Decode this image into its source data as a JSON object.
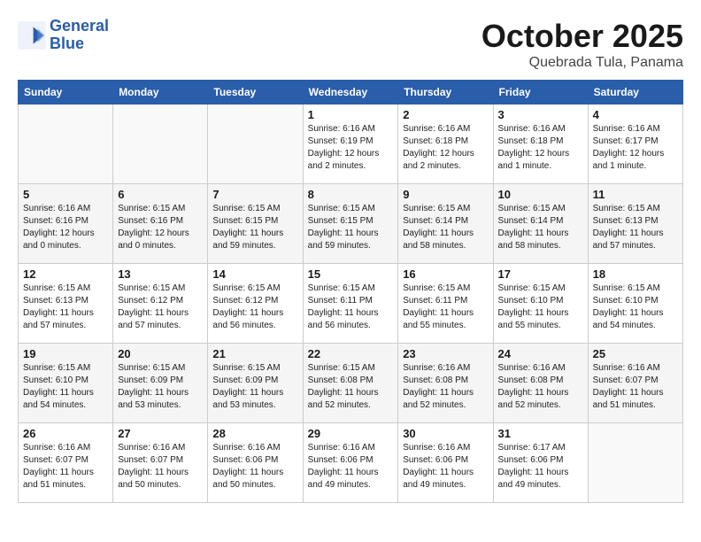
{
  "header": {
    "logo_line1": "General",
    "logo_line2": "Blue",
    "month": "October 2025",
    "location": "Quebrada Tula, Panama"
  },
  "weekdays": [
    "Sunday",
    "Monday",
    "Tuesday",
    "Wednesday",
    "Thursday",
    "Friday",
    "Saturday"
  ],
  "weeks": [
    [
      {
        "day": "",
        "info": ""
      },
      {
        "day": "",
        "info": ""
      },
      {
        "day": "",
        "info": ""
      },
      {
        "day": "1",
        "info": "Sunrise: 6:16 AM\nSunset: 6:19 PM\nDaylight: 12 hours and 2 minutes."
      },
      {
        "day": "2",
        "info": "Sunrise: 6:16 AM\nSunset: 6:18 PM\nDaylight: 12 hours and 2 minutes."
      },
      {
        "day": "3",
        "info": "Sunrise: 6:16 AM\nSunset: 6:18 PM\nDaylight: 12 hours and 1 minute."
      },
      {
        "day": "4",
        "info": "Sunrise: 6:16 AM\nSunset: 6:17 PM\nDaylight: 12 hours and 1 minute."
      }
    ],
    [
      {
        "day": "5",
        "info": "Sunrise: 6:16 AM\nSunset: 6:16 PM\nDaylight: 12 hours and 0 minutes."
      },
      {
        "day": "6",
        "info": "Sunrise: 6:15 AM\nSunset: 6:16 PM\nDaylight: 12 hours and 0 minutes."
      },
      {
        "day": "7",
        "info": "Sunrise: 6:15 AM\nSunset: 6:15 PM\nDaylight: 11 hours and 59 minutes."
      },
      {
        "day": "8",
        "info": "Sunrise: 6:15 AM\nSunset: 6:15 PM\nDaylight: 11 hours and 59 minutes."
      },
      {
        "day": "9",
        "info": "Sunrise: 6:15 AM\nSunset: 6:14 PM\nDaylight: 11 hours and 58 minutes."
      },
      {
        "day": "10",
        "info": "Sunrise: 6:15 AM\nSunset: 6:14 PM\nDaylight: 11 hours and 58 minutes."
      },
      {
        "day": "11",
        "info": "Sunrise: 6:15 AM\nSunset: 6:13 PM\nDaylight: 11 hours and 57 minutes."
      }
    ],
    [
      {
        "day": "12",
        "info": "Sunrise: 6:15 AM\nSunset: 6:13 PM\nDaylight: 11 hours and 57 minutes."
      },
      {
        "day": "13",
        "info": "Sunrise: 6:15 AM\nSunset: 6:12 PM\nDaylight: 11 hours and 57 minutes."
      },
      {
        "day": "14",
        "info": "Sunrise: 6:15 AM\nSunset: 6:12 PM\nDaylight: 11 hours and 56 minutes."
      },
      {
        "day": "15",
        "info": "Sunrise: 6:15 AM\nSunset: 6:11 PM\nDaylight: 11 hours and 56 minutes."
      },
      {
        "day": "16",
        "info": "Sunrise: 6:15 AM\nSunset: 6:11 PM\nDaylight: 11 hours and 55 minutes."
      },
      {
        "day": "17",
        "info": "Sunrise: 6:15 AM\nSunset: 6:10 PM\nDaylight: 11 hours and 55 minutes."
      },
      {
        "day": "18",
        "info": "Sunrise: 6:15 AM\nSunset: 6:10 PM\nDaylight: 11 hours and 54 minutes."
      }
    ],
    [
      {
        "day": "19",
        "info": "Sunrise: 6:15 AM\nSunset: 6:10 PM\nDaylight: 11 hours and 54 minutes."
      },
      {
        "day": "20",
        "info": "Sunrise: 6:15 AM\nSunset: 6:09 PM\nDaylight: 11 hours and 53 minutes."
      },
      {
        "day": "21",
        "info": "Sunrise: 6:15 AM\nSunset: 6:09 PM\nDaylight: 11 hours and 53 minutes."
      },
      {
        "day": "22",
        "info": "Sunrise: 6:15 AM\nSunset: 6:08 PM\nDaylight: 11 hours and 52 minutes."
      },
      {
        "day": "23",
        "info": "Sunrise: 6:16 AM\nSunset: 6:08 PM\nDaylight: 11 hours and 52 minutes."
      },
      {
        "day": "24",
        "info": "Sunrise: 6:16 AM\nSunset: 6:08 PM\nDaylight: 11 hours and 52 minutes."
      },
      {
        "day": "25",
        "info": "Sunrise: 6:16 AM\nSunset: 6:07 PM\nDaylight: 11 hours and 51 minutes."
      }
    ],
    [
      {
        "day": "26",
        "info": "Sunrise: 6:16 AM\nSunset: 6:07 PM\nDaylight: 11 hours and 51 minutes."
      },
      {
        "day": "27",
        "info": "Sunrise: 6:16 AM\nSunset: 6:07 PM\nDaylight: 11 hours and 50 minutes."
      },
      {
        "day": "28",
        "info": "Sunrise: 6:16 AM\nSunset: 6:06 PM\nDaylight: 11 hours and 50 minutes."
      },
      {
        "day": "29",
        "info": "Sunrise: 6:16 AM\nSunset: 6:06 PM\nDaylight: 11 hours and 49 minutes."
      },
      {
        "day": "30",
        "info": "Sunrise: 6:16 AM\nSunset: 6:06 PM\nDaylight: 11 hours and 49 minutes."
      },
      {
        "day": "31",
        "info": "Sunrise: 6:17 AM\nSunset: 6:06 PM\nDaylight: 11 hours and 49 minutes."
      },
      {
        "day": "",
        "info": ""
      }
    ]
  ]
}
